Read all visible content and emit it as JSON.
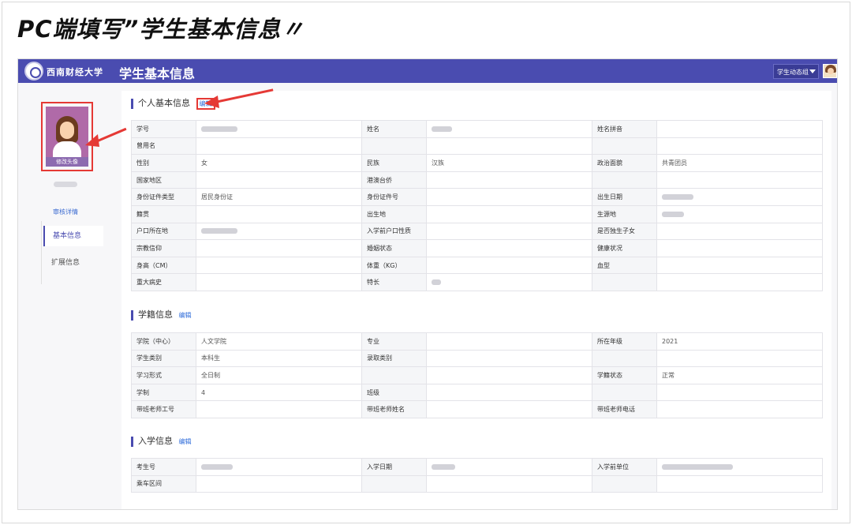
{
  "slide": {
    "title": "PC端填写”学生基本信息〃"
  },
  "topbar": {
    "logo_text": "西南财经大学",
    "app_title": "学生基本信息",
    "group_select_value": "学生动态组",
    "accent": "#4a4cb0"
  },
  "sidebar": {
    "photo_caption": "修改头像",
    "audit_link": "审核详情",
    "nav": [
      {
        "label": "基本信息",
        "active": true
      },
      {
        "label": "扩展信息",
        "active": false
      }
    ]
  },
  "sections": {
    "personal": {
      "title": "个人基本信息",
      "edit": "编辑",
      "rows": [
        {
          "l1": "学号",
          "v1": "",
          "l2": "姓名",
          "v2": "",
          "l3": "姓名拼音",
          "v3": ""
        },
        {
          "l1": "曾用名",
          "v1": "",
          "l2": "",
          "v2": "",
          "l3": "",
          "v3": ""
        },
        {
          "l1": "性别",
          "v1": "女",
          "l2": "民族",
          "v2": "汉族",
          "l3": "政治面貌",
          "v3": "共青团员"
        },
        {
          "l1": "国家地区",
          "v1": "",
          "l2": "港澳台侨",
          "v2": "",
          "l3": "",
          "v3": ""
        },
        {
          "l1": "身份证件类型",
          "v1": "居民身份证",
          "l2": "身份证件号",
          "v2": "",
          "l3": "出生日期",
          "v3": ""
        },
        {
          "l1": "籍贯",
          "v1": "",
          "l2": "出生地",
          "v2": "",
          "l3": "生源地",
          "v3": ""
        },
        {
          "l1": "户口所在地",
          "v1": "",
          "l2": "入学前户口性质",
          "v2": "",
          "l3": "是否独生子女",
          "v3": ""
        },
        {
          "l1": "宗教信仰",
          "v1": "",
          "l2": "婚姻状态",
          "v2": "",
          "l3": "健康状况",
          "v3": ""
        },
        {
          "l1": "身高（CM）",
          "v1": "",
          "l2": "体重（KG）",
          "v2": "",
          "l3": "血型",
          "v3": ""
        },
        {
          "l1": "重大病史",
          "v1": "",
          "l2": "特长",
          "v2": "",
          "l3": "",
          "v3": ""
        }
      ]
    },
    "enroll": {
      "title": "学籍信息",
      "edit": "编辑",
      "rows": [
        {
          "l1": "学院（中心）",
          "v1": "人文学院",
          "l2": "专业",
          "v2": "",
          "l3": "所在年级",
          "v3": "2021"
        },
        {
          "l1": "学生类别",
          "v1": "本科生",
          "l2": "录取类别",
          "v2": "",
          "l3": "",
          "v3": ""
        },
        {
          "l1": "学习形式",
          "v1": "全日制",
          "l2": "",
          "v2": "",
          "l3": "学籍状态",
          "v3": "正常"
        },
        {
          "l1": "学制",
          "v1": "4",
          "l2": "班级",
          "v2": "",
          "l3": "",
          "v3": ""
        },
        {
          "l1": "带班老师工号",
          "v1": "",
          "l2": "带班老师姓名",
          "v2": "",
          "l3": "带班老师电话",
          "v3": ""
        }
      ]
    },
    "admission": {
      "title": "入学信息",
      "edit": "编辑",
      "rows": [
        {
          "l1": "考生号",
          "v1": "",
          "l2": "入学日期",
          "v2": "",
          "l3": "入学前单位",
          "v3": ""
        },
        {
          "l1": "乘车区间",
          "v1": "",
          "l2": "",
          "v2": "",
          "l3": "",
          "v3": ""
        }
      ]
    }
  }
}
